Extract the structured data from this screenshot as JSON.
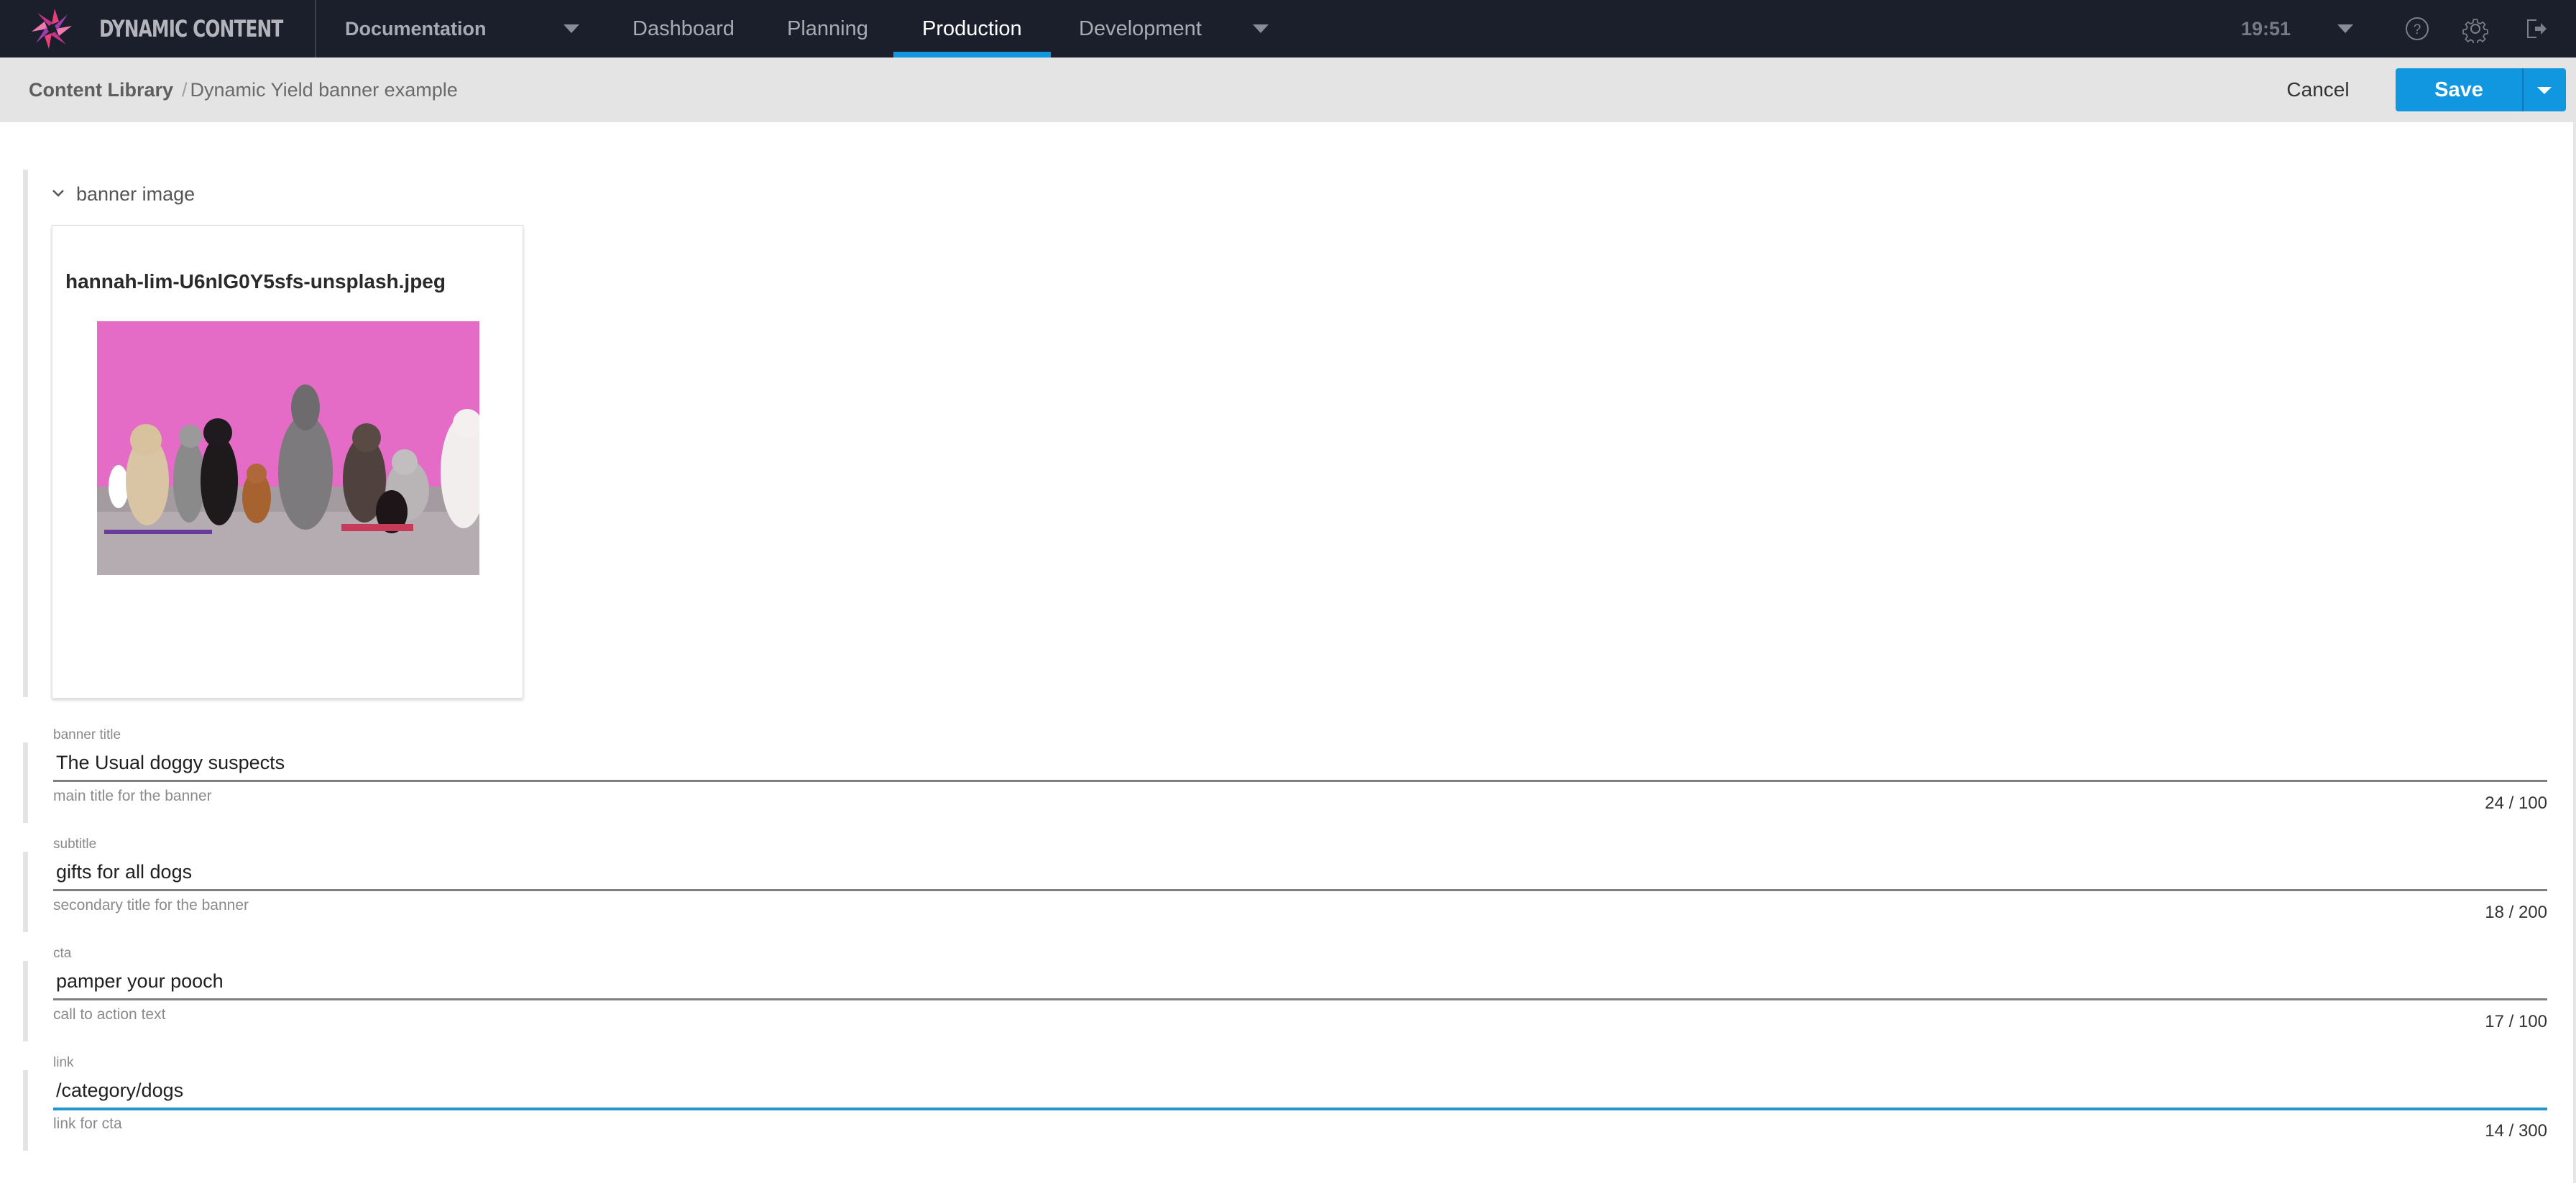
{
  "navbar": {
    "brand": "DYNAMIC CONTENT",
    "project": "Documentation",
    "tabs": [
      {
        "label": "Dashboard",
        "active": false
      },
      {
        "label": "Planning",
        "active": false
      },
      {
        "label": "Production",
        "active": true
      },
      {
        "label": "Development",
        "active": false
      }
    ],
    "time": "19:51",
    "icons": [
      "help-icon",
      "settings-icon",
      "logout-icon"
    ],
    "accent": "#1197e0"
  },
  "breadcrumb": {
    "root": "Content Library",
    "separator": "/",
    "current": "Dynamic Yield banner example"
  },
  "actions": {
    "cancel_label": "Cancel",
    "save_label": "Save"
  },
  "section": {
    "title": "banner image",
    "image_name": "hannah-lim-U6nlG0Y5sfs-unsplash.jpeg"
  },
  "fields": [
    {
      "label": "banner title",
      "value": "The Usual doggy suspects",
      "helper": "main title for the banner",
      "counter": "24 / 100",
      "focused": false
    },
    {
      "label": "subtitle",
      "value": "gifts for all dogs",
      "helper": "secondary title for the banner",
      "counter": "18 / 200",
      "focused": false
    },
    {
      "label": "cta",
      "value": "pamper your pooch",
      "helper": "call to action text",
      "counter": "17 / 100",
      "focused": false
    },
    {
      "label": "link",
      "value": "/category/dogs",
      "helper": "link for cta",
      "counter": "14 / 300",
      "focused": true
    }
  ]
}
